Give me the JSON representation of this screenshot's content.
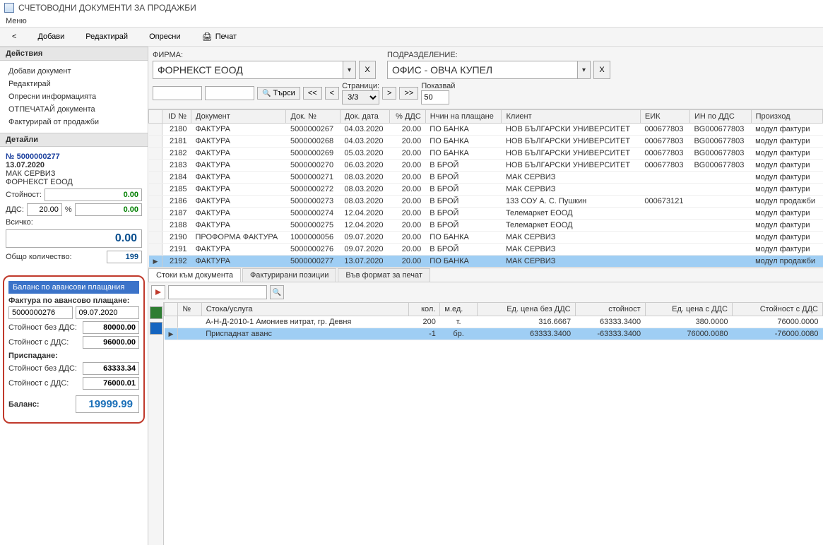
{
  "window_title": "СЧЕТОВОДНИ ДОКУМЕНТИ ЗА ПРОДАЖБИ",
  "menu": "Меню",
  "toolbar": {
    "back": "<",
    "add": "Добави",
    "edit": "Редактирай",
    "refresh": "Опресни",
    "print": "Печат"
  },
  "sidebar": {
    "actions_header": "Действия",
    "actions": [
      "Добави документ",
      "Редактирай",
      "Опресни информацията",
      "ОТПЕЧАТАЙ документа",
      "Фактурирай от продажби"
    ],
    "details_header": "Детайли",
    "details": {
      "doc_prefix": "№",
      "doc_no": "5000000277",
      "date": "13.07.2020",
      "client": "МАК СЕРВИЗ",
      "company": "ФОРНЕКСТ ЕООД",
      "value_label": "Стойност:",
      "value": "0.00",
      "vat_label": "ДДС:",
      "vat_rate": "20.00",
      "vat_pct": "%",
      "vat_amount": "0.00",
      "total_label": "Всичко:",
      "total": "0.00",
      "qty_label": "Общо количество:",
      "qty": "199"
    },
    "advance": {
      "header": "Баланс по авансови плащания",
      "invoice_label": "Фактура по авансово плащане:",
      "inv_no": "5000000276",
      "inv_date": "09.07.2020",
      "val_novat_label": "Стойност без ДДС:",
      "val_novat": "80000.00",
      "val_vat_label": "Стойност с ДДС:",
      "val_vat": "96000.00",
      "deduct_label": "Приспадане:",
      "ded_novat_label": "Стойност без ДДС:",
      "ded_novat": "63333.34",
      "ded_vat_label": "Стойност с ДДС:",
      "ded_vat": "76000.01",
      "balance_label": "Баланс:",
      "balance": "19999.99"
    }
  },
  "filters": {
    "firm_label": "ФИРМА:",
    "firm": "ФОРНЕКСТ ЕООД",
    "dept_label": "ПОДРАЗДЕЛЕНИЕ:",
    "dept": "ОФИС - ОВЧА КУПЕЛ",
    "x_btn": "X",
    "search_btn": "Търси",
    "first": "<<",
    "prev": "<",
    "pages_label": "Страници:",
    "pages_value": "3/3",
    "next": ">",
    "last": ">>",
    "show_label": "Показвай",
    "show_value": "50"
  },
  "grid": {
    "headers": [
      "ID №",
      "Документ",
      "Док. №",
      "Док. дата",
      "% ДДС",
      "Нчин на плащане",
      "Клиент",
      "ЕИК",
      "ИН по ДДС",
      "Произход"
    ],
    "rows": [
      {
        "id": "2180",
        "doc": "ФАКТУРА",
        "no": "5000000267",
        "date": "04.03.2020",
        "vat": "20.00",
        "pay": "ПО БАНКА",
        "client": "НОВ БЪЛГАРСКИ УНИВЕРСИТЕТ",
        "eik": "000677803",
        "vatid": "BG000677803",
        "src": "модул фактури"
      },
      {
        "id": "2181",
        "doc": "ФАКТУРА",
        "no": "5000000268",
        "date": "04.03.2020",
        "vat": "20.00",
        "pay": "ПО БАНКА",
        "client": "НОВ БЪЛГАРСКИ УНИВЕРСИТЕТ",
        "eik": "000677803",
        "vatid": "BG000677803",
        "src": "модул фактури"
      },
      {
        "id": "2182",
        "doc": "ФАКТУРА",
        "no": "5000000269",
        "date": "05.03.2020",
        "vat": "20.00",
        "pay": "ПО БАНКА",
        "client": "НОВ БЪЛГАРСКИ УНИВЕРСИТЕТ",
        "eik": "000677803",
        "vatid": "BG000677803",
        "src": "модул фактури"
      },
      {
        "id": "2183",
        "doc": "ФАКТУРА",
        "no": "5000000270",
        "date": "06.03.2020",
        "vat": "20.00",
        "pay": "В БРОЙ",
        "client": "НОВ БЪЛГАРСКИ УНИВЕРСИТЕТ",
        "eik": "000677803",
        "vatid": "BG000677803",
        "src": "модул фактури"
      },
      {
        "id": "2184",
        "doc": "ФАКТУРА",
        "no": "5000000271",
        "date": "08.03.2020",
        "vat": "20.00",
        "pay": "В БРОЙ",
        "client": "МАК СЕРВИЗ",
        "eik": "",
        "vatid": "",
        "src": "модул фактури"
      },
      {
        "id": "2185",
        "doc": "ФАКТУРА",
        "no": "5000000272",
        "date": "08.03.2020",
        "vat": "20.00",
        "pay": "В БРОЙ",
        "client": "МАК СЕРВИЗ",
        "eik": "",
        "vatid": "",
        "src": "модул фактури"
      },
      {
        "id": "2186",
        "doc": "ФАКТУРА",
        "no": "5000000273",
        "date": "08.03.2020",
        "vat": "20.00",
        "pay": "В БРОЙ",
        "client": "133 СОУ А. С. Пушкин",
        "eik": "000673121",
        "vatid": "",
        "src": "модул продажби"
      },
      {
        "id": "2187",
        "doc": "ФАКТУРА",
        "no": "5000000274",
        "date": "12.04.2020",
        "vat": "20.00",
        "pay": "В БРОЙ",
        "client": "Телемаркет ЕООД",
        "eik": "",
        "vatid": "",
        "src": "модул фактури"
      },
      {
        "id": "2188",
        "doc": "ФАКТУРА",
        "no": "5000000275",
        "date": "12.04.2020",
        "vat": "20.00",
        "pay": "В БРОЙ",
        "client": "Телемаркет ЕООД",
        "eik": "",
        "vatid": "",
        "src": "модул фактури"
      },
      {
        "id": "2190",
        "doc": "ПРОФОРМА ФАКТУРА",
        "no": "1000000056",
        "date": "09.07.2020",
        "vat": "20.00",
        "pay": "ПО БАНКА",
        "client": "МАК СЕРВИЗ",
        "eik": "",
        "vatid": "",
        "src": "модул фактури"
      },
      {
        "id": "2191",
        "doc": "ФАКТУРА",
        "no": "5000000276",
        "date": "09.07.2020",
        "vat": "20.00",
        "pay": "В БРОЙ",
        "client": "МАК СЕРВИЗ",
        "eik": "",
        "vatid": "",
        "src": "модул фактури"
      },
      {
        "id": "2192",
        "doc": "ФАКТУРА",
        "no": "5000000277",
        "date": "13.07.2020",
        "vat": "20.00",
        "pay": "ПО БАНКА",
        "client": "МАК СЕРВИЗ",
        "eik": "",
        "vatid": "",
        "src": "модул продажби",
        "sel": true
      }
    ]
  },
  "tabs": {
    "t1": "Стоки към документа",
    "t2": "Фактурирани позиции",
    "t3": "Във формат за печат"
  },
  "subgrid": {
    "headers": [
      "№",
      "Стока/услуга",
      "кол.",
      "м.ед.",
      "Ед. цена без ДДС",
      "стойност",
      "Ед. цена с ДДС",
      "Стойност с ДДС"
    ],
    "rows": [
      {
        "n": "",
        "name": "А-Н-Д-2010-1 Амониев нитрат, гр. Девня",
        "q": "200",
        "u": "т.",
        "pnv": "316.6667",
        "val": "63333.3400",
        "pv": "380.0000",
        "valv": "76000.0000"
      },
      {
        "n": "",
        "name": "Приспаднат аванс",
        "q": "-1",
        "u": "бр.",
        "pnv": "63333.3400",
        "val": "-63333.3400",
        "pv": "76000.0080",
        "valv": "-76000.0080",
        "sel": true
      }
    ]
  }
}
